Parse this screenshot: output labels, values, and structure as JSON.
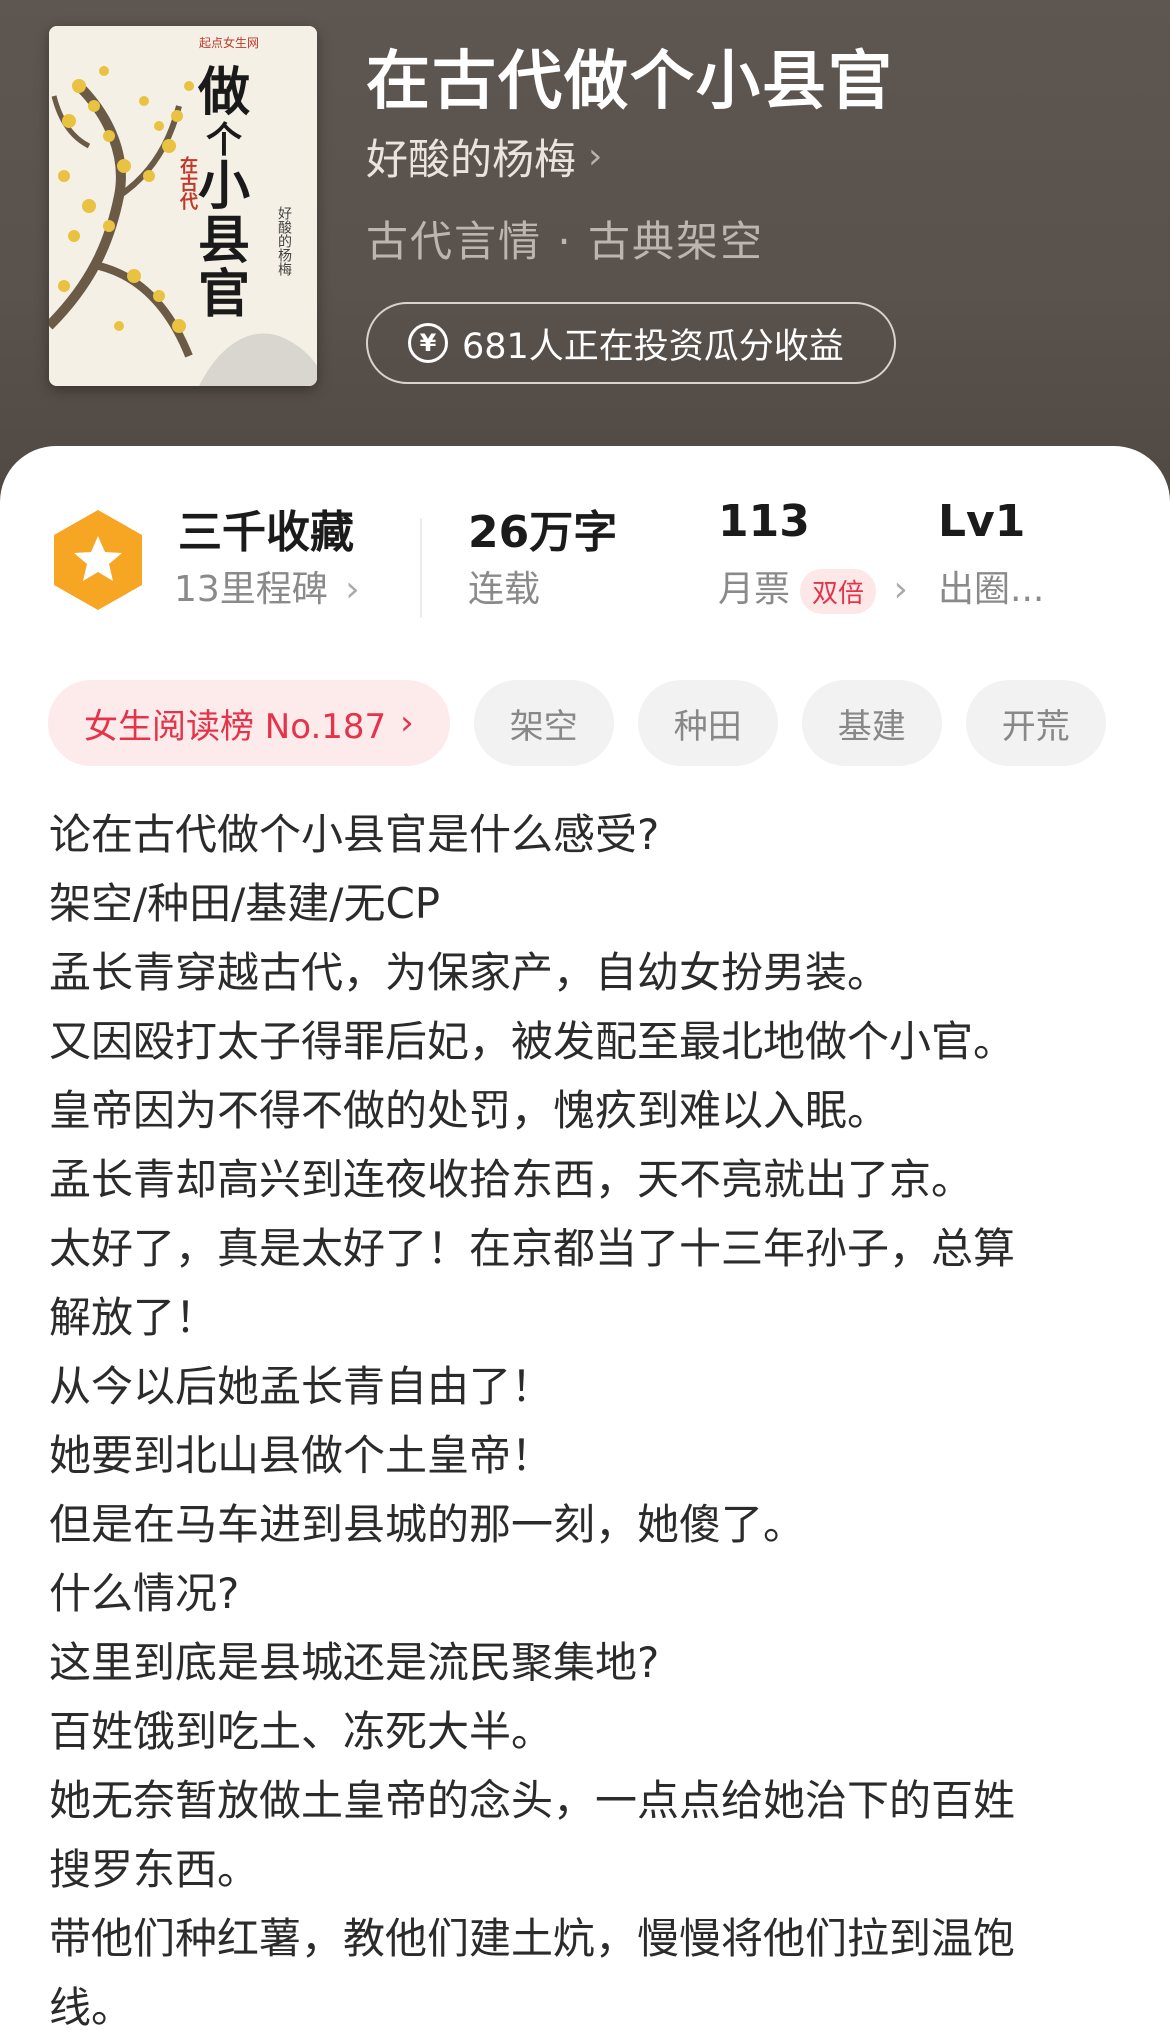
{
  "book": {
    "title": "在古代做个小县官",
    "author": "好酸的杨梅",
    "genre": "古代言情 · 古典架空",
    "invest_text": "681人正在投资瓜分收益",
    "cover": {
      "publisher": "起点女生网",
      "title_lines": [
        "做",
        "个",
        "小",
        "县",
        "官"
      ],
      "seal": "在古代",
      "author": "好酸的杨梅"
    }
  },
  "stats": {
    "favorites": "三千收藏",
    "milestones": "13里程碑",
    "words": "26万字",
    "status": "连载",
    "monthly_tickets": "113",
    "monthly_label": "月票",
    "double": "双倍",
    "level": "Lv1",
    "level_label": "出圈..."
  },
  "tags": {
    "rank": "女生阅读榜 No.187",
    "items": [
      "架空",
      "种田",
      "基建",
      "开荒"
    ]
  },
  "description": [
    "论在古代做个小县官是什么感受?",
    "架空/种田/基建/无CP",
    "孟长青穿越古代，为保家产，自幼女扮男装。",
    "又因殴打太子得罪后妃，被发配至最北地做个小官。",
    "皇帝因为不得不做的处罚，愧疚到难以入眠。",
    "孟长青却高兴到连夜收拾东西，天不亮就出了京。",
    "太好了，真是太好了！在京都当了十三年孙子，总算",
    "解放了！",
    "从今以后她孟长青自由了！",
    "她要到北山县做个土皇帝！",
    "但是在马车进到县城的那一刻，她傻了。",
    "什么情况?",
    "这里到底是县城还是流民聚集地?",
    "百姓饿到吃土、冻死大半。",
    "她无奈暂放做土皇帝的念头，一点点给她治下的百姓",
    "搜罗东西。",
    "带他们种红薯，教他们建土炕，慢慢将他们拉到温饱",
    "线。"
  ],
  "colors": {
    "hero_bg": "#5a524c",
    "accent_red": "#e5334a",
    "badge_orange": "#f6a623"
  }
}
